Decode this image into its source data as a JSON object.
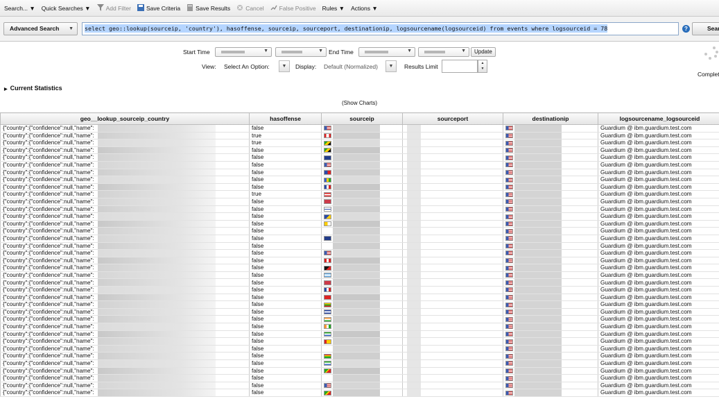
{
  "toolbar": {
    "items": [
      {
        "label": "Search... ▼",
        "icon": "",
        "disabled": false
      },
      {
        "label": "Quick Searches ▼",
        "icon": "",
        "disabled": false
      },
      {
        "label": "Add Filter",
        "icon": "filter-icon",
        "disabled": true
      },
      {
        "label": "Save Criteria",
        "icon": "save-icon",
        "disabled": false
      },
      {
        "label": "Save Results",
        "icon": "save-results-icon",
        "disabled": false
      },
      {
        "label": "Cancel",
        "icon": "cancel-icon",
        "disabled": true
      },
      {
        "label": "False Positive",
        "icon": "false-positive-icon",
        "disabled": true
      },
      {
        "label": "Rules ▼",
        "icon": "",
        "disabled": false
      },
      {
        "label": "Actions ▼",
        "icon": "",
        "disabled": false
      }
    ]
  },
  "search": {
    "mode": "Advanced Search",
    "query": "select geo::lookup(sourceip, 'country'), hasoffense, sourceip, sourceport, destinationip, logsourcename(logsourceid) from events where logsourceid = 78",
    "button": "Search",
    "help": "?"
  },
  "options": {
    "start_time_label": "Start Time",
    "end_time_label": "End Time",
    "update_label": "Update",
    "view_label": "View:",
    "view_value": "Select An Option:",
    "display_label": "Display:",
    "display_value": "Default (Normalized)",
    "results_limit_label": "Results Limit",
    "status": "Complete",
    "current_statistics": "Current Statistics",
    "show_charts": "(Show Charts)"
  },
  "colors": {
    "accent": "#2a6ebb",
    "selection": "#b5d5ff"
  },
  "table": {
    "columns": [
      "geo__lookup_sourceip_country",
      "hasoffense",
      "sourceip",
      "sourceport",
      "destinationip",
      "logsourcename_logsourceid"
    ],
    "rows": [
      {
        "country": "{\"country\":{\"confidence\":null,\"name\":",
        "hasoffense": "false",
        "logsource": "Guardium @ ibm.guardium.test.com",
        "flag": "us"
      },
      {
        "country": "{\"country\":{\"confidence\":null,\"name\":",
        "hasoffense": "true",
        "logsource": "Guardium @ ibm.guardium.test.com",
        "flag": "ca"
      },
      {
        "country": "{\"country\":{\"confidence\":null,\"name\":",
        "hasoffense": "true",
        "logsource": "Guardium @ ibm.guardium.test.com",
        "flag": "jm"
      },
      {
        "country": "{\"country\":{\"confidence\":null,\"name\":",
        "hasoffense": "false",
        "logsource": "Guardium @ ibm.guardium.test.com",
        "flag": "jm"
      },
      {
        "country": "{\"country\":{\"confidence\":null,\"name\":",
        "hasoffense": "false",
        "logsource": "Guardium @ ibm.guardium.test.com",
        "flag": "nz"
      },
      {
        "country": "{\"country\":{\"confidence\":null,\"name\":",
        "hasoffense": "false",
        "logsource": "Guardium @ ibm.guardium.test.com",
        "flag": "us"
      },
      {
        "country": "{\"country\":{\"confidence\":null,\"name\":",
        "hasoffense": "false",
        "logsource": "Guardium @ ibm.guardium.test.com",
        "flag": "do"
      },
      {
        "country": "{\"country\":{\"confidence\":null,\"name\":",
        "hasoffense": "false",
        "logsource": "Guardium @ ibm.guardium.test.com",
        "flag": "vc"
      },
      {
        "country": "{\"country\":{\"confidence\":null,\"name\":",
        "hasoffense": "false",
        "logsource": "Guardium @ ibm.guardium.test.com",
        "flag": "fr"
      },
      {
        "country": "{\"country\":{\"confidence\":null,\"name\":",
        "hasoffense": "true",
        "logsource": "Guardium @ ibm.guardium.test.com",
        "flag": "at"
      },
      {
        "country": "{\"country\":{\"confidence\":null,\"name\":",
        "hasoffense": "false",
        "logsource": "Guardium @ ibm.guardium.test.com",
        "flag": "gb"
      },
      {
        "country": "{\"country\":{\"confidence\":null,\"name\":",
        "hasoffense": "false",
        "logsource": "Guardium @ ibm.guardium.test.com",
        "flag": "fi"
      },
      {
        "country": "{\"country\":{\"confidence\":null,\"name\":",
        "hasoffense": "false",
        "logsource": "Guardium @ ibm.guardium.test.com",
        "flag": "ba"
      },
      {
        "country": "{\"country\":{\"confidence\":null,\"name\":",
        "hasoffense": "false",
        "logsource": "Guardium @ ibm.guardium.test.com",
        "flag": "va"
      },
      {
        "country": "{\"country\":{\"confidence\":null,\"name\":",
        "hasoffense": "false",
        "logsource": "Guardium @ ibm.guardium.test.com",
        "flag": ""
      },
      {
        "country": "{\"country\":{\"confidence\":null,\"name\":",
        "hasoffense": "false",
        "logsource": "Guardium @ ibm.guardium.test.com",
        "flag": "au"
      },
      {
        "country": "{\"country\":{\"confidence\":null,\"name\":",
        "hasoffense": "false",
        "logsource": "Guardium @ ibm.guardium.test.com",
        "flag": ""
      },
      {
        "country": "{\"country\":{\"confidence\":null,\"name\":",
        "hasoffense": "false",
        "logsource": "Guardium @ ibm.guardium.test.com",
        "flag": "us"
      },
      {
        "country": "{\"country\":{\"confidence\":null,\"name\":",
        "hasoffense": "false",
        "logsource": "Guardium @ ibm.guardium.test.com",
        "flag": "pe"
      },
      {
        "country": "{\"country\":{\"confidence\":null,\"name\":",
        "hasoffense": "false",
        "logsource": "Guardium @ ibm.guardium.test.com",
        "flag": "pg"
      },
      {
        "country": "{\"country\":{\"confidence\":null,\"name\":",
        "hasoffense": "false",
        "logsource": "Guardium @ ibm.guardium.test.com",
        "flag": "ar"
      },
      {
        "country": "{\"country\":{\"confidence\":null,\"name\":",
        "hasoffense": "false",
        "logsource": "Guardium @ ibm.guardium.test.com",
        "flag": "gb"
      },
      {
        "country": "{\"country\":{\"confidence\":null,\"name\":",
        "hasoffense": "false",
        "logsource": "Guardium @ ibm.guardium.test.com",
        "flag": "fr"
      },
      {
        "country": "{\"country\":{\"confidence\":null,\"name\":",
        "hasoffense": "false",
        "logsource": "Guardium @ ibm.guardium.test.com",
        "flag": "cn"
      },
      {
        "country": "{\"country\":{\"confidence\":null,\"name\":",
        "hasoffense": "false",
        "logsource": "Guardium @ ibm.guardium.test.com",
        "flag": "mm"
      },
      {
        "country": "{\"country\":{\"confidence\":null,\"name\":",
        "hasoffense": "false",
        "logsource": "Guardium @ ibm.guardium.test.com",
        "flag": "sv"
      },
      {
        "country": "{\"country\":{\"confidence\":null,\"name\":",
        "hasoffense": "false",
        "logsource": "Guardium @ ibm.guardium.test.com",
        "flag": "in"
      },
      {
        "country": "{\"country\":{\"confidence\":null,\"name\":",
        "hasoffense": "false",
        "logsource": "Guardium @ ibm.guardium.test.com",
        "flag": "ci"
      },
      {
        "country": "{\"country\":{\"confidence\":null,\"name\":",
        "hasoffense": "false",
        "logsource": "Guardium @ ibm.guardium.test.com",
        "flag": "sl"
      },
      {
        "country": "{\"country\":{\"confidence\":null,\"name\":",
        "hasoffense": "false",
        "logsource": "Guardium @ ibm.guardium.test.com",
        "flag": "gw"
      },
      {
        "country": "{\"country\":{\"confidence\":null,\"name\":",
        "hasoffense": "false",
        "logsource": "Guardium @ ibm.guardium.test.com",
        "flag": ""
      },
      {
        "country": "{\"country\":{\"confidence\":null,\"name\":",
        "hasoffense": "false",
        "logsource": "Guardium @ ibm.guardium.test.com",
        "flag": "gd"
      },
      {
        "country": "{\"country\":{\"confidence\":null,\"name\":",
        "hasoffense": "false",
        "logsource": "Guardium @ ibm.guardium.test.com",
        "flag": "sl"
      },
      {
        "country": "{\"country\":{\"confidence\":null,\"name\":",
        "hasoffense": "false",
        "logsource": "Guardium @ ibm.guardium.test.com",
        "flag": "za"
      },
      {
        "country": "{\"country\":{\"confidence\":null,\"name\":",
        "hasoffense": "false",
        "logsource": "Guardium @ ibm.guardium.test.com",
        "flag": ""
      },
      {
        "country": "{\"country\":{\"confidence\":null,\"name\":",
        "hasoffense": "false",
        "logsource": "Guardium @ ibm.guardium.test.com",
        "flag": "us"
      },
      {
        "country": "{\"country\":{\"confidence\":null,\"name\":",
        "hasoffense": "false",
        "logsource": "Guardium @ ibm.guardium.test.com",
        "flag": "gy"
      }
    ]
  }
}
